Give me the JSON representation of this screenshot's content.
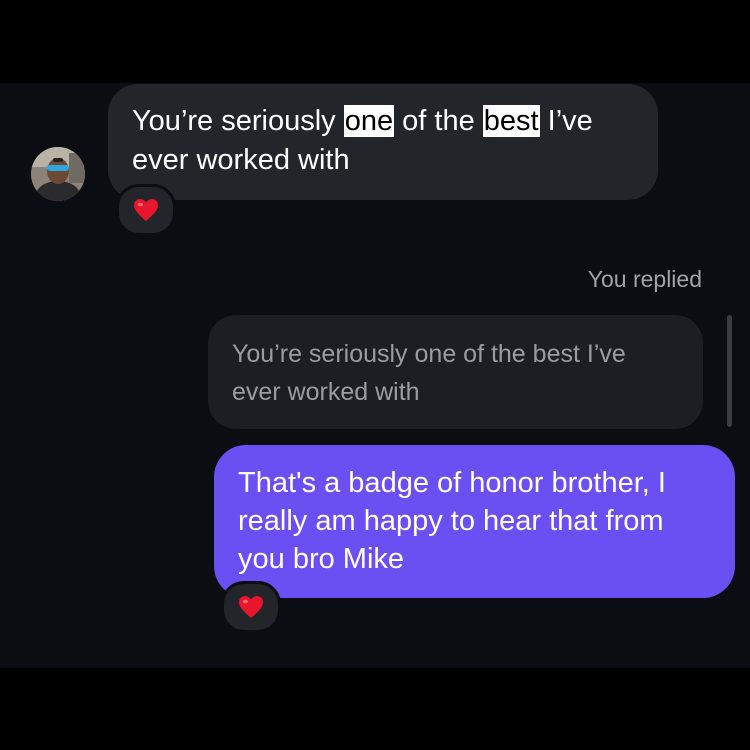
{
  "incoming_message": {
    "segments": [
      {
        "text": "You’re seriously ",
        "highlight": false
      },
      {
        "text": "one",
        "highlight": true
      },
      {
        "text": " of the ",
        "highlight": false
      },
      {
        "text": "best",
        "highlight": true
      },
      {
        "text": " I’ve ever worked with",
        "highlight": false
      }
    ],
    "reaction": "heart"
  },
  "reply": {
    "label": "You replied",
    "quoted_text": "You’re seriously one of the best I’ve ever worked with",
    "message": "That's a badge of honor brother, I really am happy to hear that from you bro Mike",
    "reaction": "heart"
  },
  "colors": {
    "background": "#0b0d12",
    "incoming_bubble": "#23252b",
    "outgoing_bubble": "#6a4ff3",
    "reaction_heart": "#e8162c"
  }
}
